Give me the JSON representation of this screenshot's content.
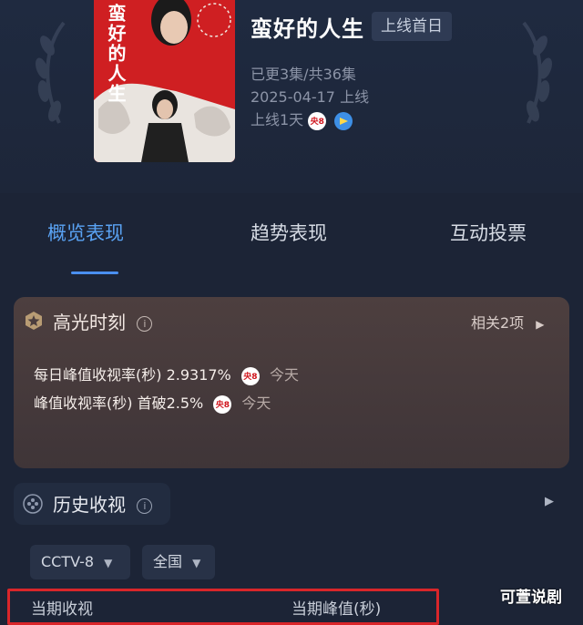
{
  "show": {
    "title": "蛮好的人生",
    "first_day_badge": "上线首日",
    "episodes": "已更3集/共36集",
    "release": "2025-04-17 上线",
    "online_days": "上线1天",
    "poster_title": "蛮好的人生",
    "channel_badge": "央8"
  },
  "tabs": [
    {
      "label": "概览表现",
      "active": true
    },
    {
      "label": "趋势表现",
      "active": false
    },
    {
      "label": "互动投票",
      "active": false
    }
  ],
  "highlight": {
    "title": "高光时刻",
    "related": "相关2项",
    "items": [
      {
        "text": "每日峰值收视率(秒) 2.9317%",
        "badge": "央8",
        "date": "今天"
      },
      {
        "text": "峰值收视率(秒) 首破2.5%",
        "badge": "央8",
        "date": "今天"
      }
    ]
  },
  "history": {
    "title": "历史收视",
    "channel_select": "CCTV-8",
    "region_select": "全国",
    "col_current": "当期收视",
    "col_peak": "当期峰值(秒)"
  },
  "watermark": "可萱说剧",
  "colors": {
    "accent_tab": "#5aa3f4",
    "highlight_border": "#d9262a",
    "poster_red": "#cf1f22"
  }
}
